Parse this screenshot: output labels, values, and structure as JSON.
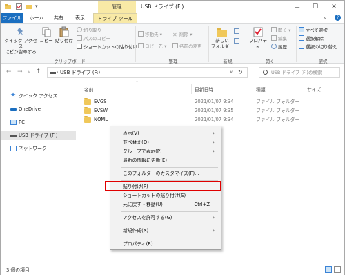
{
  "window": {
    "title": "USB ドライブ (F:)",
    "tools_header": "管理",
    "minimize": "—",
    "maximize": "☐",
    "close": "✕"
  },
  "tabs": [
    "ファイル",
    "ホーム",
    "共有",
    "表示",
    "ドライブ ツール"
  ],
  "ribbon": {
    "quick_access_line1": "クイック アクセス",
    "quick_access_line2": "にピン留めする",
    "copy": "コピー",
    "paste": "貼り付け",
    "cut": "切り取り",
    "copy_path": "パスのコピー",
    "paste_shortcut": "ショートカットの貼り付け",
    "group_clipboard": "クリップボード",
    "move_to": "移動先",
    "copy_to": "コピー先",
    "delete": "削除",
    "rename": "名前の変更",
    "group_organize": "整理",
    "new_folder_line1": "新しい",
    "new_folder_line2": "フォルダー",
    "group_new": "新規",
    "properties": "プロパティ",
    "open": "開く",
    "edit": "編集",
    "history": "履歴",
    "group_open": "開く",
    "select_all": "すべて選択",
    "select_none": "選択解除",
    "invert_selection": "選択の切り替え",
    "group_select": "選択"
  },
  "address": {
    "path": "USB ドライブ (F:)",
    "search_placeholder": "USB ドライブ (F:)の検索"
  },
  "nav": [
    {
      "label": "クイック アクセス",
      "icon": "star-icon"
    },
    {
      "label": "OneDrive",
      "icon": "cloud-icon"
    },
    {
      "label": "PC",
      "icon": "computer-icon"
    },
    {
      "label": "USB ドライブ (F:)",
      "icon": "usb-drive-icon",
      "selected": true
    },
    {
      "label": "ネットワーク",
      "icon": "network-icon"
    }
  ],
  "columns": {
    "name": "名前",
    "date": "更新日時",
    "type": "種類",
    "size": "サイズ"
  },
  "files": [
    {
      "name": "EVGS",
      "date": "2021/01/07 9:34",
      "type": "ファイル フォルダー"
    },
    {
      "name": "EVSW",
      "date": "2021/01/07 9:35",
      "type": "ファイル フォルダー"
    },
    {
      "name": "NOML",
      "date": "2021/01/07 9:34",
      "type": "ファイル フォルダー"
    }
  ],
  "context_menu": {
    "view": "表示(V)",
    "sort_by": "並べ替え(O)",
    "group_by": "グループで表示(P)",
    "refresh": "最新の情報に更新(E)",
    "customize": "このフォルダーのカスタマイズ(F)...",
    "paste": "貼り付け(P)",
    "paste_shortcut": "ショートカットの貼り付け(S)",
    "undo_move": "元に戻す - 移動(U)",
    "undo_shortcut": "Ctrl+Z",
    "give_access": "アクセスを許可する(G)",
    "new": "新規作成(X)",
    "properties": "プロパティ(R)"
  },
  "status": {
    "item_count": "3 個の項目"
  },
  "colors": {
    "file_tab": "#1a6ec0",
    "drive_tools_tab": "#f8e9a6",
    "highlight_box": "#e00000",
    "folder": "#f0c85a"
  }
}
